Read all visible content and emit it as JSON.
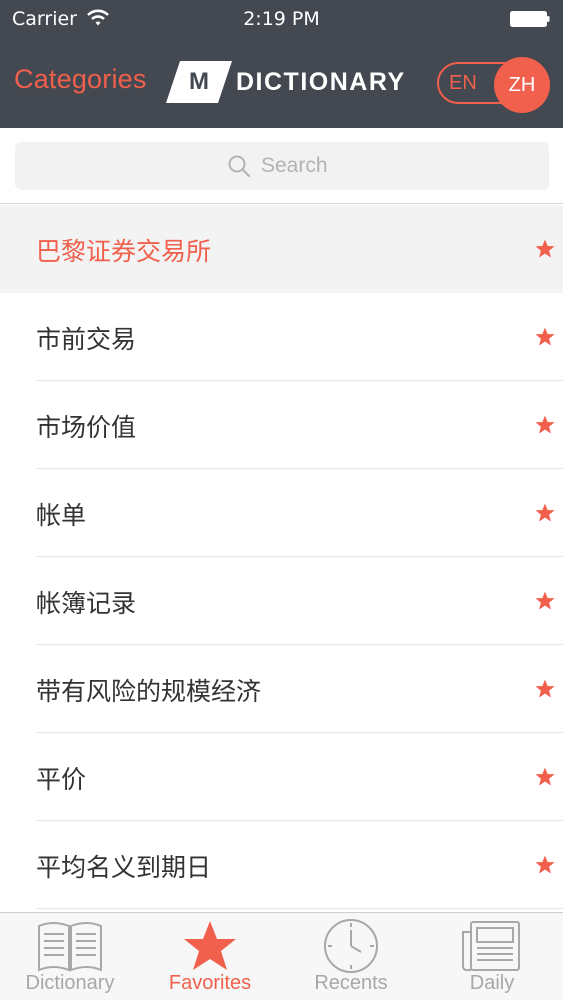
{
  "status_bar": {
    "carrier": "Carrier",
    "time": "2:19 PM"
  },
  "nav": {
    "categories_label": "Categories",
    "logo_letter": "M",
    "logo_word": "DICTIONARY",
    "lang_en": "EN",
    "lang_zh": "ZH",
    "active_lang": "ZH"
  },
  "search": {
    "placeholder": "Search",
    "value": ""
  },
  "favorites": [
    {
      "label": "巴黎证券交易所",
      "selected": true
    },
    {
      "label": "市前交易",
      "selected": false
    },
    {
      "label": "市场价值",
      "selected": false
    },
    {
      "label": "帐单",
      "selected": false
    },
    {
      "label": "帐簿记录",
      "selected": false
    },
    {
      "label": "带有风险的规模经济",
      "selected": false
    },
    {
      "label": "平价",
      "selected": false
    },
    {
      "label": "平均名义到期日",
      "selected": false
    }
  ],
  "tabs": [
    {
      "label": "Dictionary",
      "icon": "book-icon",
      "active": false
    },
    {
      "label": "Favorites",
      "icon": "star-icon",
      "active": true
    },
    {
      "label": "Recents",
      "icon": "clock-icon",
      "active": false
    },
    {
      "label": "Daily",
      "icon": "newspaper-icon",
      "active": false
    }
  ],
  "colors": {
    "accent": "#f0604c",
    "header_bg": "#434851",
    "selected_row_bg": "#f3f3f3",
    "inactive_tab": "#a8a8a8"
  }
}
